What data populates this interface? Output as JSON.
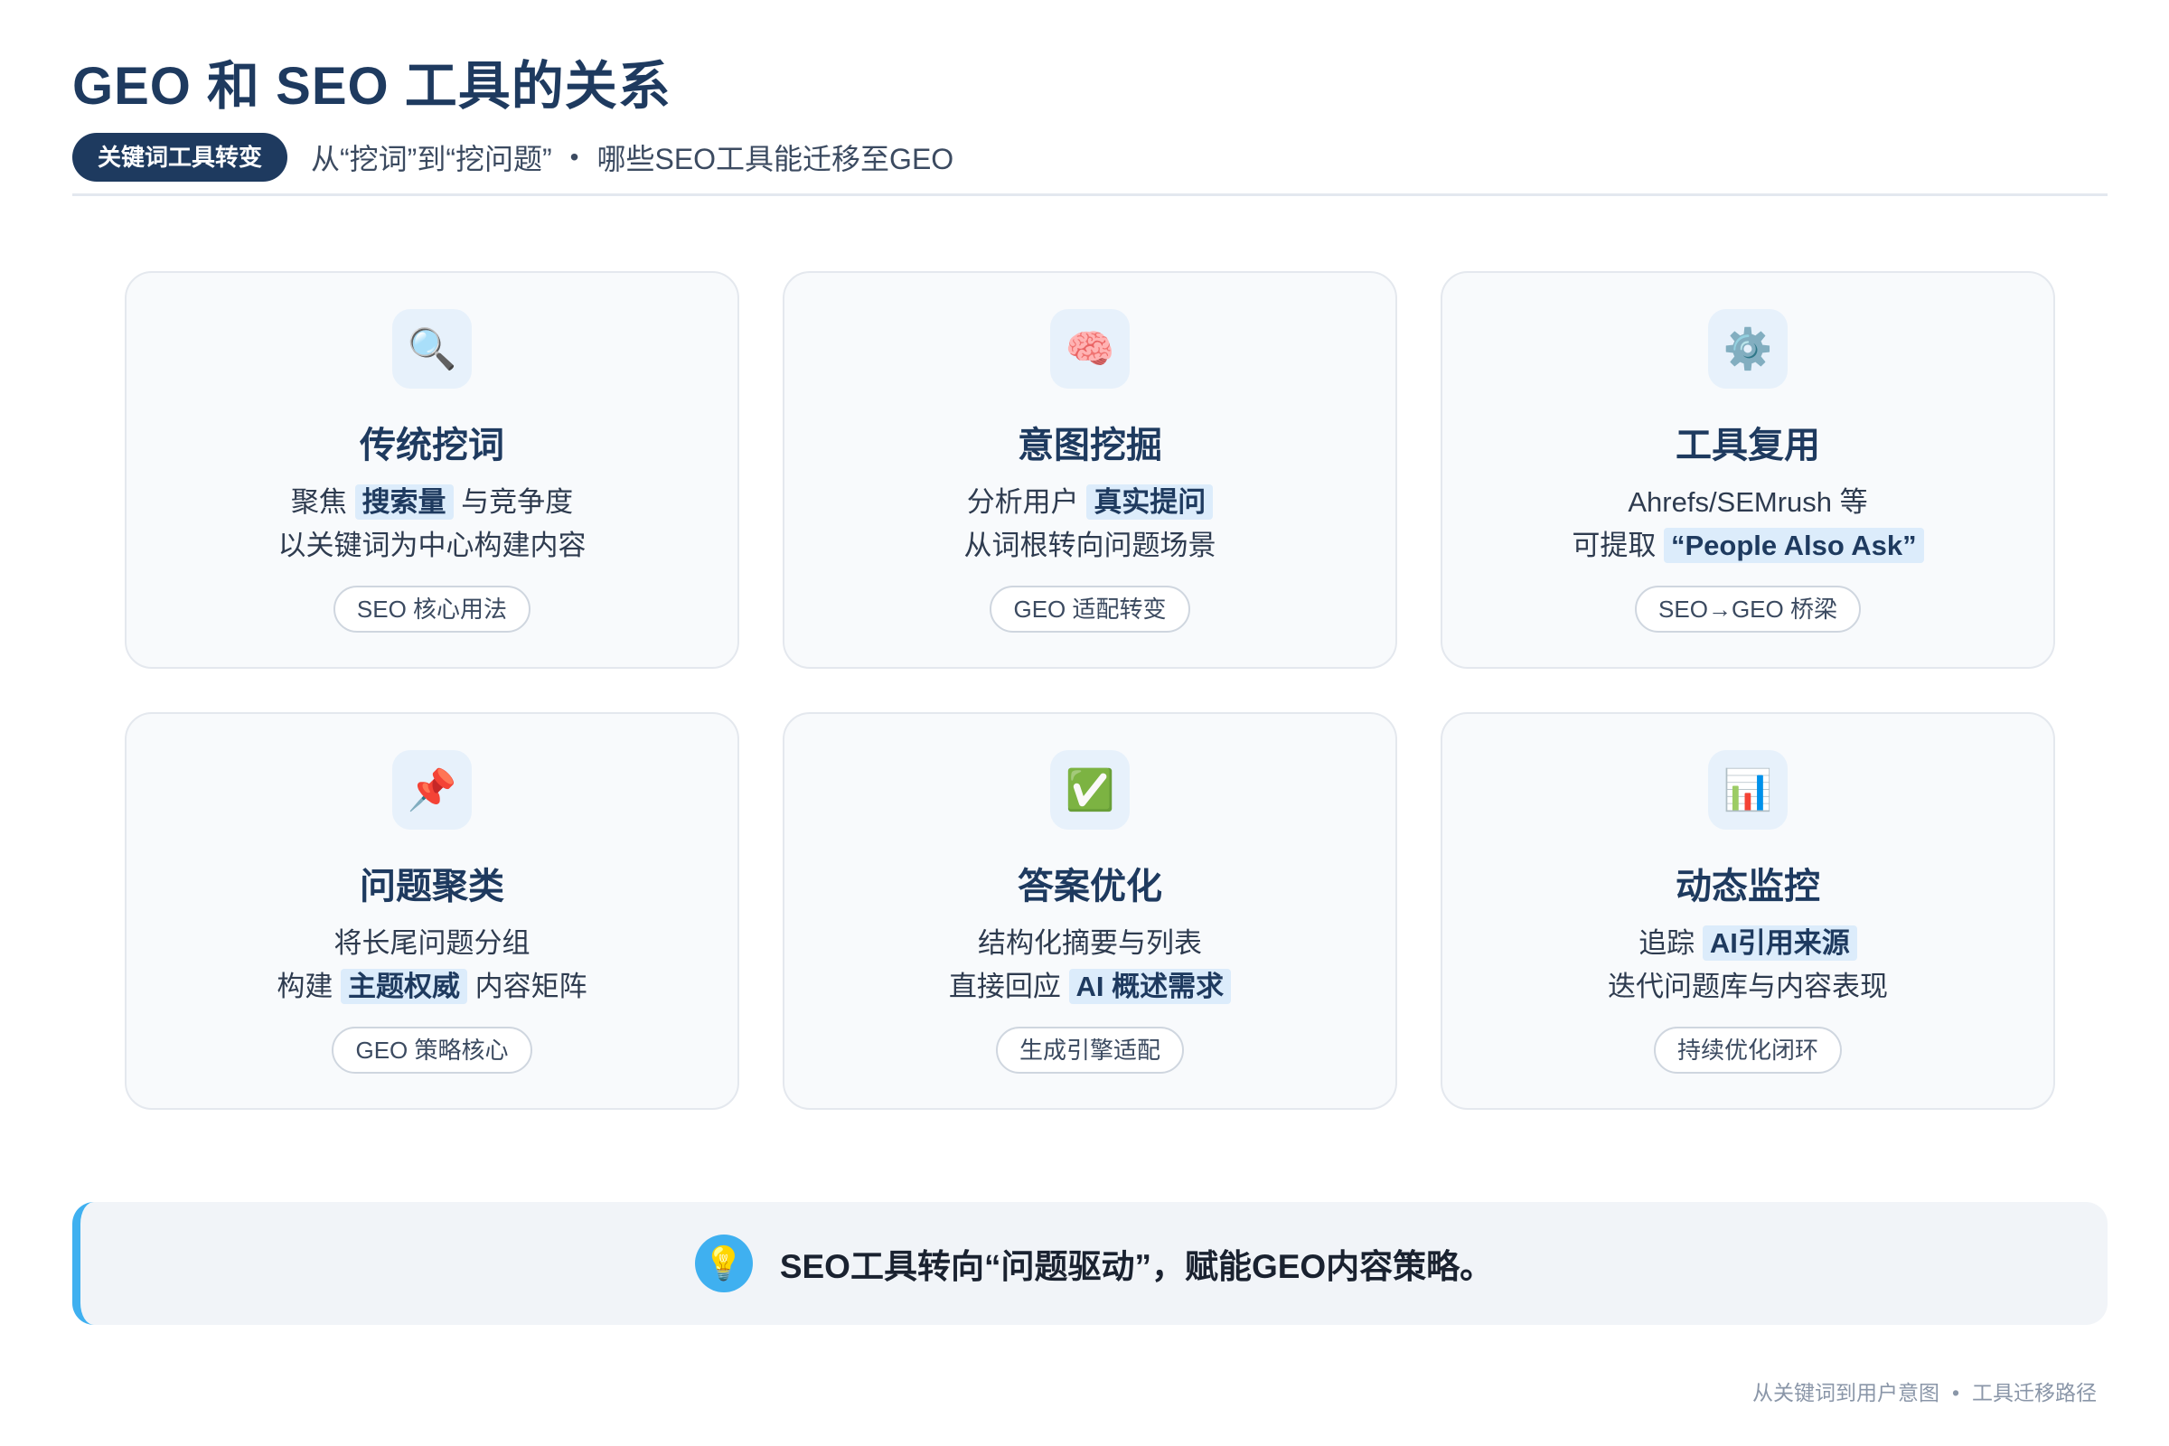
{
  "header": {
    "title": "GEO 和 SEO 工具的关系",
    "badge": "关键词工具转变",
    "subtitle": "从“挖词”到“挖问题”",
    "bullet": "•",
    "subtitle2": "哪些SEO工具能迁移至GEO"
  },
  "cards": [
    {
      "icon": "magnifier-icon",
      "glyph": "🔍",
      "title": "传统挖词",
      "l1_pre": "聚焦",
      "l1_hl": "搜索量",
      "l1_post": "与竞争度",
      "l2_pre": "以关键词为中心构建内容",
      "l2_hl": "",
      "l2_post": "",
      "tag": "SEO 核心用法"
    },
    {
      "icon": "brain-icon",
      "glyph": "🧠",
      "title": "意图挖掘",
      "l1_pre": "分析用户",
      "l1_hl": "真实提问",
      "l1_post": "",
      "l2_pre": "从词根转向问题场景",
      "l2_hl": "",
      "l2_post": "",
      "tag": "GEO 适配转变"
    },
    {
      "icon": "gear-icon",
      "glyph": "⚙️",
      "title": "工具复用",
      "l1_pre": "Ahrefs/SEMrush 等",
      "l1_hl": "",
      "l1_post": "",
      "l2_pre": "可提取",
      "l2_hl": "“People Also Ask”",
      "l2_post": "",
      "tag": "SEO→GEO 桥梁"
    },
    {
      "icon": "pushpin-icon",
      "glyph": "📌",
      "title": "问题聚类",
      "l1_pre": "将长尾问题分组",
      "l1_hl": "",
      "l1_post": "",
      "l2_pre": "构建",
      "l2_hl": "主题权威",
      "l2_post": "内容矩阵",
      "tag": "GEO 策略核心"
    },
    {
      "icon": "check-mark-icon",
      "glyph": "✅",
      "title": "答案优化",
      "l1_pre": "结构化摘要与列表",
      "l1_hl": "",
      "l1_post": "",
      "l2_pre": "直接回应",
      "l2_hl": "AI 概述需求",
      "l2_post": "",
      "tag": "生成引擎适配"
    },
    {
      "icon": "bar-chart-icon",
      "glyph": "📊",
      "title": "动态监控",
      "l1_pre": "追踪",
      "l1_hl": "AI引用来源",
      "l1_post": "",
      "l2_pre": "迭代问题库与内容表现",
      "l2_hl": "",
      "l2_post": "",
      "tag": "持续优化闭环"
    }
  ],
  "callout": {
    "icon": "lightbulb-icon",
    "glyph": "💡",
    "text": "SEO工具转向“问题驱动”，赋能GEO内容策略。"
  },
  "footer": {
    "left": "从关键词到用户意图",
    "sep": "•",
    "right": "工具迁移路径"
  }
}
